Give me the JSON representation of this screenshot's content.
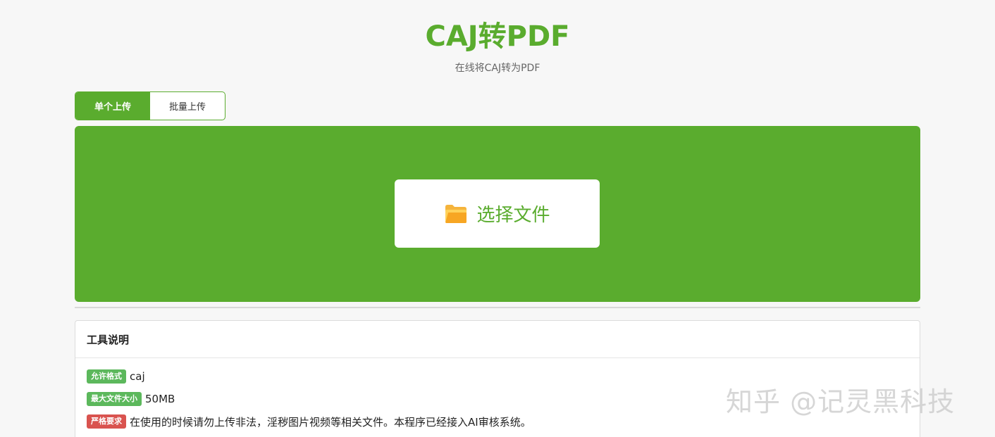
{
  "header": {
    "title": "CAJ转PDF",
    "subtitle": "在线将CAJ转为PDF"
  },
  "tabs": [
    {
      "label": "单个上传",
      "active": true
    },
    {
      "label": "批量上传",
      "active": false
    }
  ],
  "upload": {
    "button_label": "选择文件",
    "icon": "folder-icon",
    "background_color": "#5aac2e"
  },
  "info_panel": {
    "title": "工具说明",
    "rows": [
      {
        "badge": "允许格式",
        "badge_color": "#5cb85c",
        "value": "caj"
      },
      {
        "badge": "最大文件大小",
        "badge_color": "#5cb85c",
        "value": "50MB"
      },
      {
        "badge": "严格要求",
        "badge_color": "#d9534f",
        "value": "在使用的时候请勿上传非法，淫秽图片视频等相关文件。本程序已经接入AI审核系统。"
      }
    ]
  },
  "watermark": "知乎 @记灵黑科技",
  "colors": {
    "accent": "#5aac2e",
    "page_background": "#f7f7f7"
  }
}
